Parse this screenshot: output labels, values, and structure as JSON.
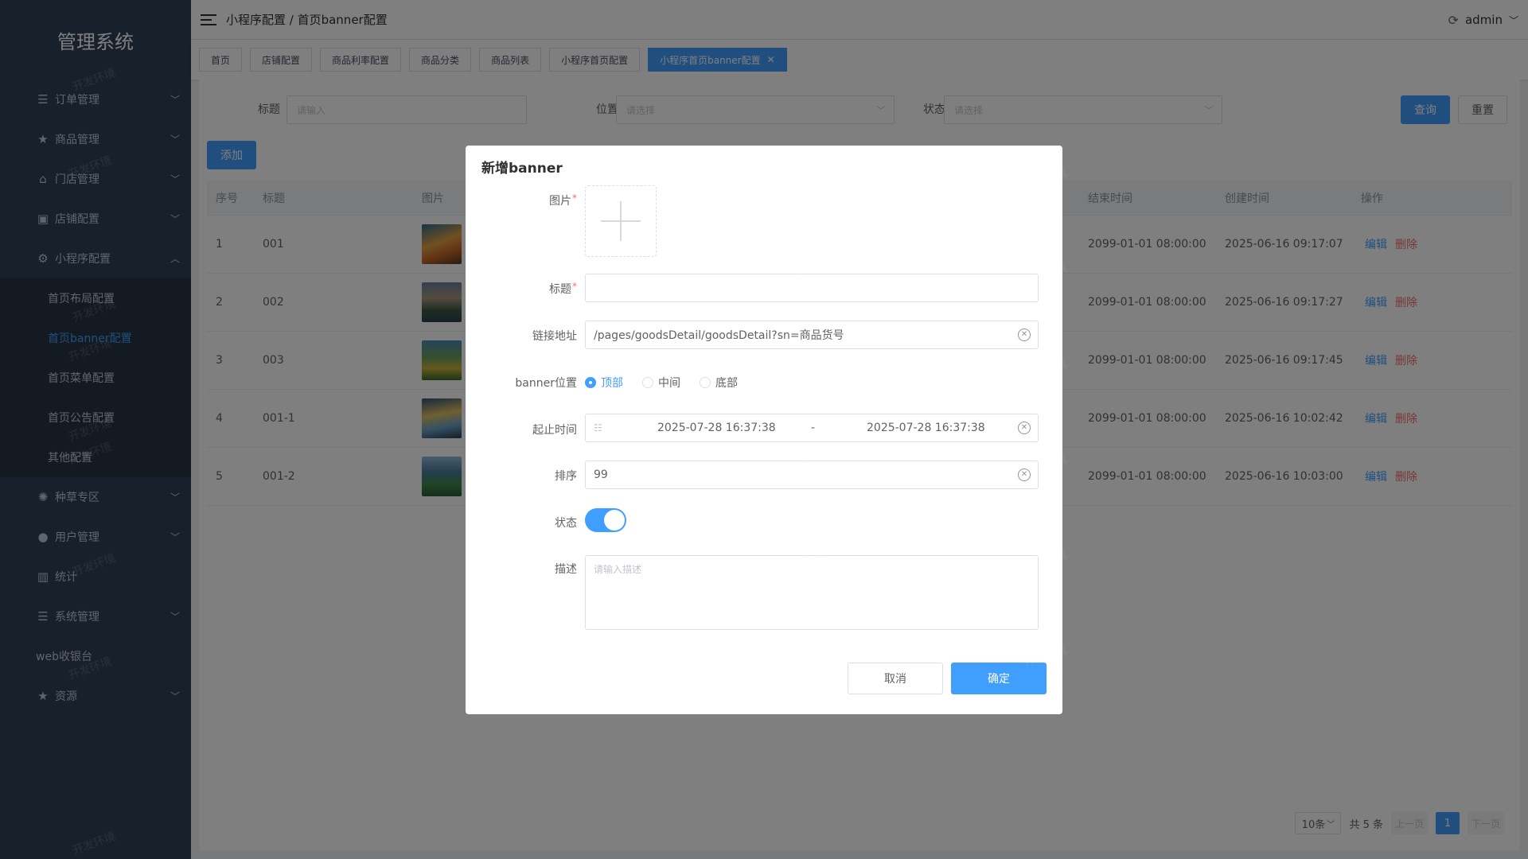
{
  "sidebar": {
    "brand": "管理系统",
    "items": [
      {
        "label": "订单管理",
        "icon": "list-icon",
        "glyph": "☰",
        "arrow": "down"
      },
      {
        "label": "商品管理",
        "icon": "star-icon",
        "glyph": "★",
        "arrow": "down"
      },
      {
        "label": "门店管理",
        "icon": "home-icon",
        "glyph": "⌂",
        "arrow": "down"
      },
      {
        "label": "店铺配置",
        "icon": "shop-icon",
        "glyph": "▣",
        "arrow": "down"
      },
      {
        "label": "小程序配置",
        "icon": "gear-icon",
        "glyph": "⚙",
        "arrow": "up"
      }
    ],
    "sub_items": [
      {
        "label": "首页布局配置"
      },
      {
        "label": "首页banner配置"
      },
      {
        "label": "首页菜单配置"
      },
      {
        "label": "首页公告配置"
      },
      {
        "label": "其他配置"
      }
    ],
    "items2": [
      {
        "label": "种草专区",
        "icon": "grass-icon",
        "glyph": "✺",
        "arrow": "down"
      },
      {
        "label": "用户管理",
        "icon": "user-icon",
        "glyph": "👤",
        "arrow": "down"
      },
      {
        "label": "统计",
        "icon": "map-icon",
        "glyph": "▥",
        "arrow": ""
      },
      {
        "label": "系统管理",
        "icon": "list-icon",
        "glyph": "☰",
        "arrow": "down"
      },
      {
        "label": "web收银台",
        "icon": "",
        "glyph": "",
        "arrow": ""
      },
      {
        "label": "资源",
        "icon": "star-icon",
        "glyph": "★",
        "arrow": "down"
      }
    ],
    "watermark": "开发环境"
  },
  "header": {
    "breadcrumb": "小程序配置 / 首页banner配置",
    "user": "admin"
  },
  "tags": [
    {
      "label": "首页"
    },
    {
      "label": "店铺配置"
    },
    {
      "label": "商品利率配置"
    },
    {
      "label": "商品分类"
    },
    {
      "label": "商品列表"
    },
    {
      "label": "小程序首页配置"
    },
    {
      "label": "小程序首页banner配置",
      "active": true
    }
  ],
  "search": {
    "title_label": "标题",
    "title_placeholder": "请输入",
    "position_label": "位置",
    "position_placeholder": "请选择",
    "status_label": "状态",
    "status_placeholder": "请选择",
    "query": "查询",
    "reset": "重置"
  },
  "add_button": "添加",
  "table": {
    "columns": {
      "index": "序号",
      "title": "标题",
      "image": "图片",
      "end_time": "结束时间",
      "created": "创建时间",
      "ops": "操作"
    },
    "rows": [
      {
        "index": "1",
        "title": "001",
        "end": "2099-01-01 08:00:00",
        "created": "2025-06-16 09:17:07"
      },
      {
        "index": "2",
        "title": "002",
        "end": "2099-01-01 08:00:00",
        "created": "2025-06-16 09:17:27"
      },
      {
        "index": "3",
        "title": "003",
        "end": "2099-01-01 08:00:00",
        "created": "2025-06-16 09:17:45"
      },
      {
        "index": "4",
        "title": "001-1",
        "end": "2099-01-01 08:00:00",
        "created": "2025-06-16 10:02:42"
      },
      {
        "index": "5",
        "title": "001-2",
        "end": "2099-01-01 08:00:00",
        "created": "2025-06-16 10:03:00"
      }
    ],
    "edit": "编辑",
    "delete": "删除"
  },
  "pagination": {
    "size": "10条",
    "total": "共 5 条",
    "prev": "上一页",
    "page": "1",
    "next": "下一页"
  },
  "dialog": {
    "title": "新增banner",
    "image_label": "图片",
    "title_label": "标题",
    "title_value": "",
    "link_label": "链接地址",
    "link_value": "/pages/goodsDetail/goodsDetail?sn=商品货号",
    "position_label": "banner位置",
    "positions": [
      "顶部",
      "中间",
      "底部"
    ],
    "range_label": "起止时间",
    "range_start": "2025-07-28 16:37:38",
    "range_sep": "-",
    "range_end": "2025-07-28 16:37:38",
    "sort_label": "排序",
    "sort_value": "99",
    "status_label": "状态",
    "status_on": true,
    "desc_label": "描述",
    "desc_placeholder": "请输入描述",
    "cancel": "取消",
    "confirm": "确定"
  },
  "colors": {
    "primary": "#409eff",
    "danger": "#f56c6c",
    "sidebar_bg": "#304156"
  }
}
